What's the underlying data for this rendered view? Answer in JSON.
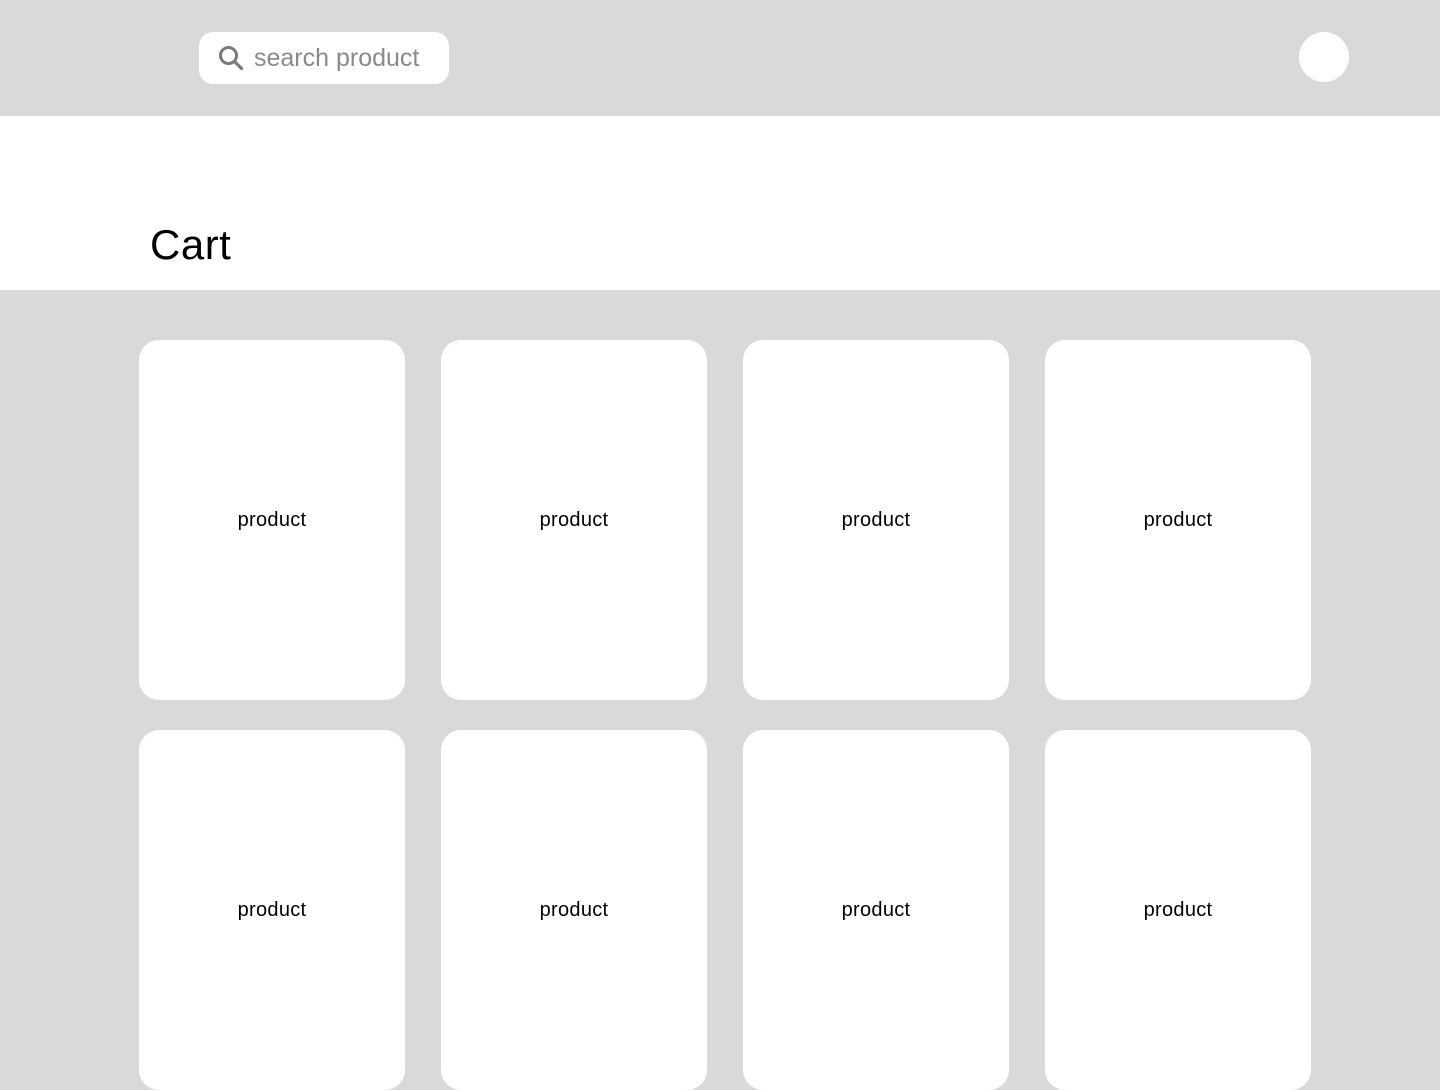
{
  "header": {
    "search": {
      "placeholder": "search product",
      "icon": "search-icon"
    },
    "avatar": {
      "icon": "avatar"
    }
  },
  "main": {
    "title": "Cart",
    "products": [
      {
        "label": "product"
      },
      {
        "label": "product"
      },
      {
        "label": "product"
      },
      {
        "label": "product"
      },
      {
        "label": "product"
      },
      {
        "label": "product"
      },
      {
        "label": "product"
      },
      {
        "label": "product"
      }
    ]
  },
  "colors": {
    "background": "#d9d9d9",
    "surface": "#ffffff",
    "text": "#000000",
    "placeholder": "#8a8a8a"
  }
}
